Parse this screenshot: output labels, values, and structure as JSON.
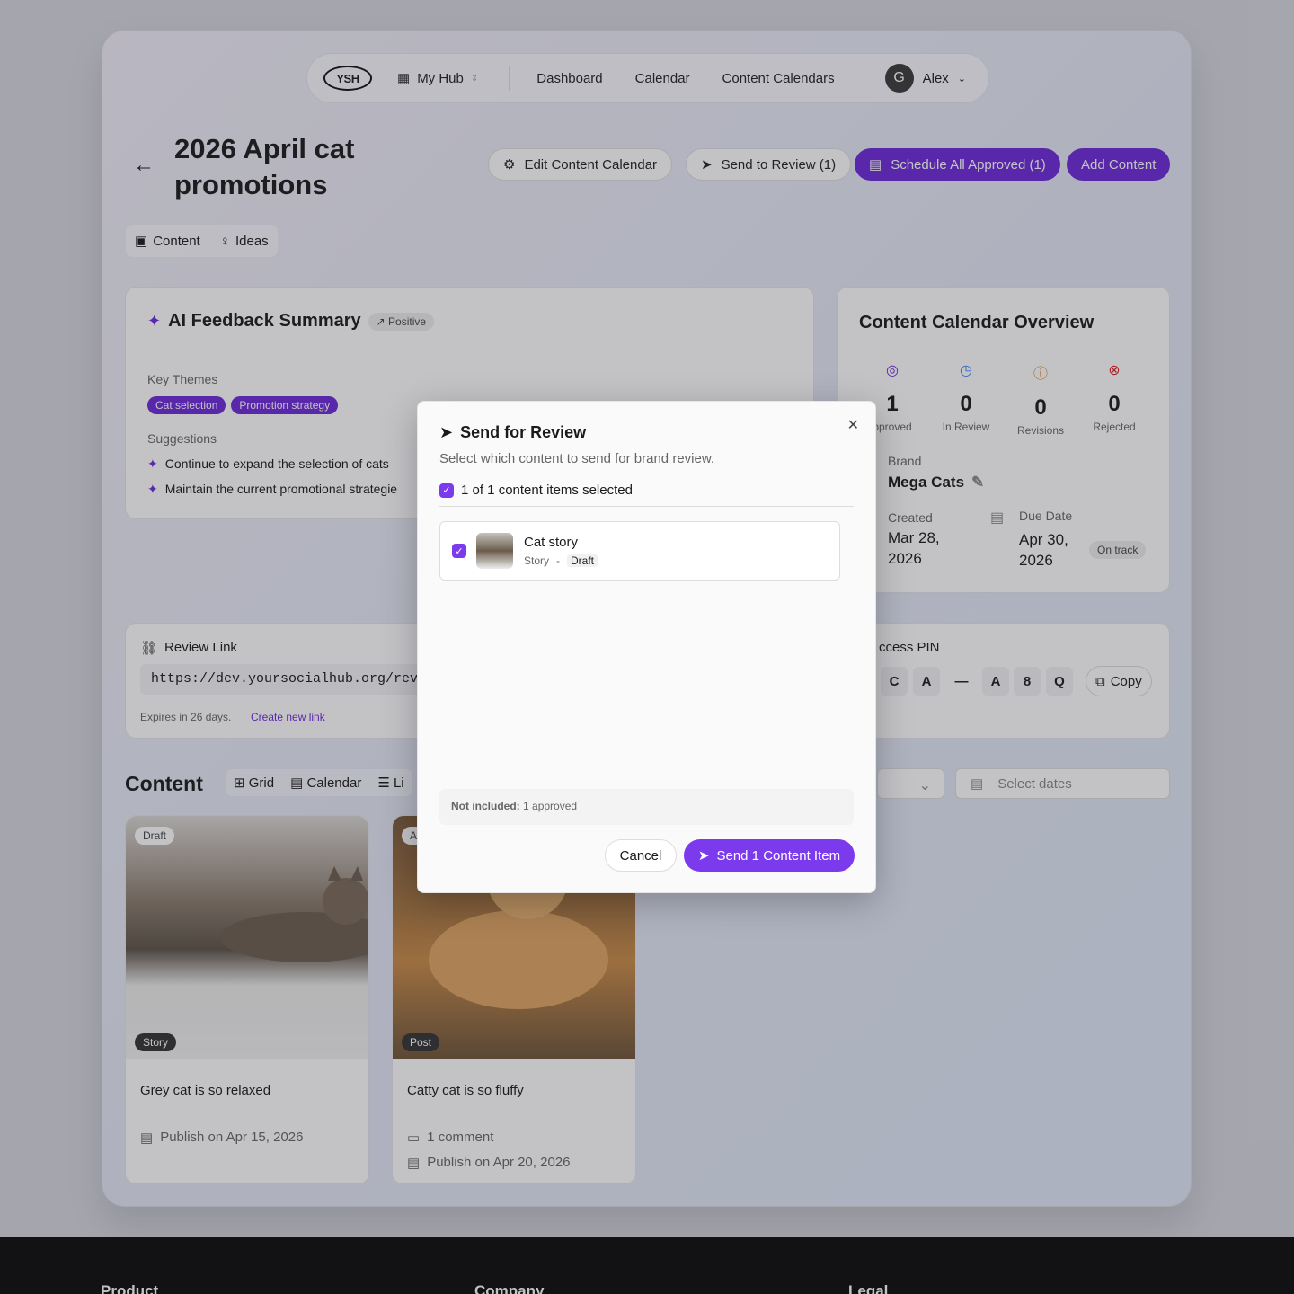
{
  "nav": {
    "logo": "YSH",
    "hub": "My Hub",
    "links": [
      "Dashboard",
      "Calendar",
      "Content Calendars"
    ],
    "avatar_initial": "G",
    "user": "Alex"
  },
  "page": {
    "title": "2026 April cat promotions",
    "edit": "Edit Content Calendar",
    "send_review": "Send to Review (1)",
    "schedule": "Schedule All Approved (1)",
    "add": "Add Content"
  },
  "tabs": {
    "content": "Content",
    "ideas": "Ideas"
  },
  "ai": {
    "title": "AI Feedback Summary",
    "sentiment": "Positive",
    "key_themes": "Key Themes",
    "themes": [
      "Cat selection",
      "Promotion strategy"
    ],
    "suggestions_label": "Suggestions",
    "suggestions": [
      "Continue to expand the selection of cats",
      "Maintain the current promotional strategie"
    ]
  },
  "overview": {
    "title": "Content Calendar Overview",
    "stats": [
      {
        "num": "1",
        "label": "pproved"
      },
      {
        "num": "0",
        "label": "In Review"
      },
      {
        "num": "0",
        "label": "Revisions"
      },
      {
        "num": "0",
        "label": "Rejected"
      }
    ],
    "brand_label": "Brand",
    "brand": "Mega Cats",
    "created_label": "Created",
    "created": "Mar 28, 2026",
    "due_label": "Due Date",
    "due": "Apr 30, 2026",
    "status": "On track"
  },
  "review": {
    "label": "Review Link",
    "url": "https://dev.yoursocialhub.org/review",
    "expires": "Expires in 26 days.",
    "new_link": "Create new link",
    "pin_label": "ccess PIN",
    "pin": [
      "C",
      "A",
      "—",
      "A",
      "8",
      "Q"
    ],
    "copy": "Copy"
  },
  "content": {
    "title": "Content",
    "views": [
      "Grid",
      "Calendar",
      "Li"
    ],
    "dates_placeholder": "Select dates",
    "cards": [
      {
        "status": "Draft",
        "type": "Story",
        "title": "Grey cat is so relaxed",
        "publish": "Publish on Apr 15, 2026"
      },
      {
        "status": "A",
        "type": "Post",
        "title": "Catty cat is so fluffy",
        "comments": "1 comment",
        "publish": "Publish on Apr 20, 2026"
      }
    ]
  },
  "modal": {
    "title": "Send for Review",
    "subtitle": "Select which content to send for brand review.",
    "selected": "1 of 1 content items selected",
    "item_title": "Cat story",
    "item_type": "Story",
    "item_sep": "-",
    "item_status": "Draft",
    "not_included_label": "Not included:",
    "not_included": "1 approved",
    "cancel": "Cancel",
    "send": "Send 1 Content Item"
  },
  "footer": {
    "cols": [
      "Product",
      "Company",
      "Legal"
    ]
  },
  "colors": {
    "accent": "#6d28d9"
  }
}
